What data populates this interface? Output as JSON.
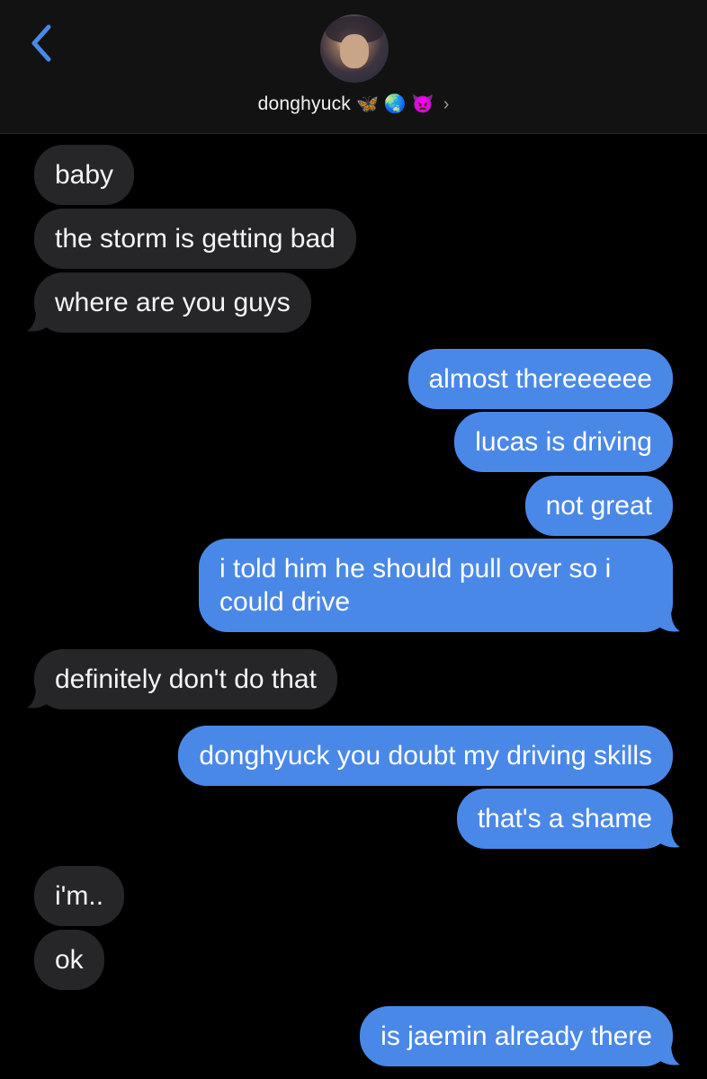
{
  "header": {
    "contact_name": "donghyuck",
    "emojis": [
      "🦋",
      "🌏",
      "👿"
    ],
    "chevron": "›",
    "icons": {
      "back": "chevron-left-icon",
      "avatar": "contact-avatar"
    },
    "accent_color": "#4a88e8"
  },
  "messages": [
    {
      "from": "them",
      "text": "baby"
    },
    {
      "from": "them",
      "text": "the storm is getting bad"
    },
    {
      "from": "them",
      "text": "where are you guys"
    },
    {
      "from": "me",
      "text": "almost thereeeeee"
    },
    {
      "from": "me",
      "text": "lucas is driving"
    },
    {
      "from": "me",
      "text": "not great"
    },
    {
      "from": "me",
      "text": "i told him he should pull over so i could drive"
    },
    {
      "from": "them",
      "text": "definitely don't do that"
    },
    {
      "from": "me",
      "text": "donghyuck you doubt my driving skills"
    },
    {
      "from": "me",
      "text": "that's a shame"
    },
    {
      "from": "them",
      "text": "i'm.."
    },
    {
      "from": "them",
      "text": "ok"
    },
    {
      "from": "me",
      "text": "is jaemin already there"
    }
  ]
}
